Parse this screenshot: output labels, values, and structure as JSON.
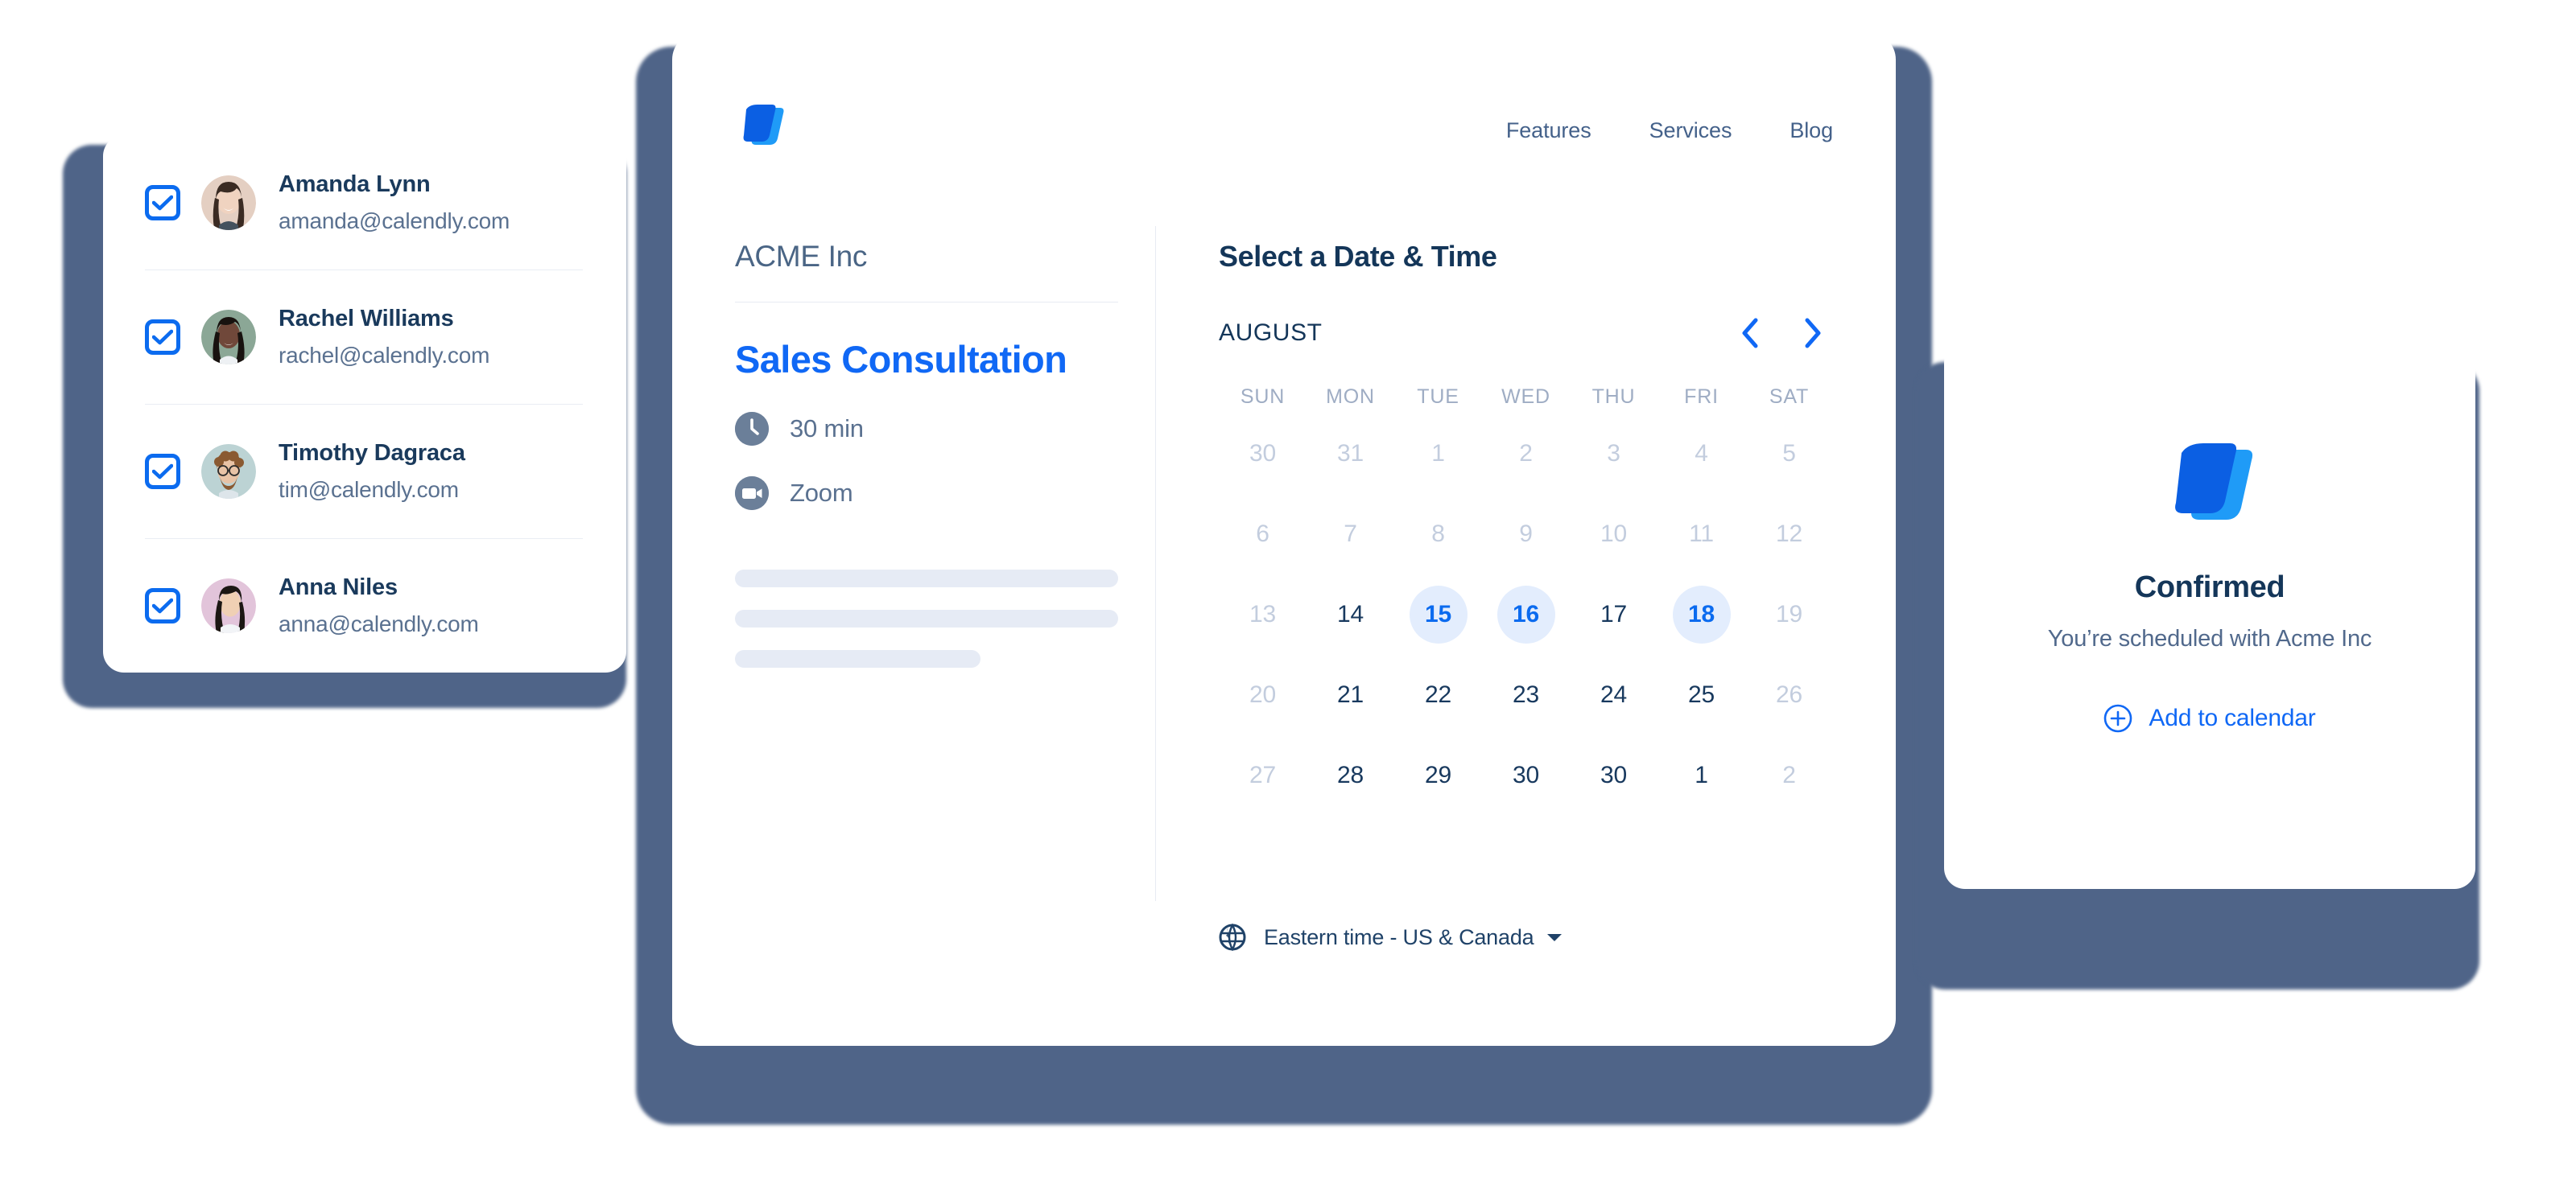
{
  "brand": {
    "logo_icon": "calendly-logo-icon",
    "logo_color_front": "#0b6bef",
    "logo_color_back": "#1f9bf7"
  },
  "contacts_panel": {
    "name": "contact-selection-list",
    "items": [
      {
        "checkbox_icon": "checkbox-checked-icon",
        "checked": true,
        "avatar_icon": "avatar-amanda-lynn",
        "avatar_bg": "#e4cfc2",
        "name": "Amanda Lynn",
        "email": "amanda@calendly.com"
      },
      {
        "checkbox_icon": "checkbox-checked-icon",
        "checked": true,
        "avatar_icon": "avatar-rachel-williams",
        "avatar_bg": "#8ba796",
        "name": "Rachel Williams",
        "email": "rachel@calendly.com"
      },
      {
        "checkbox_icon": "checkbox-checked-icon",
        "checked": true,
        "avatar_icon": "avatar-timothy-dagraca",
        "avatar_bg": "#bcd3d4",
        "name": "Timothy Dagraca",
        "email": "tim@calendly.com"
      },
      {
        "checkbox_icon": "checkbox-checked-icon",
        "checked": true,
        "avatar_icon": "avatar-anna-niles",
        "avatar_bg": "#e2c4da",
        "name": "Anna Niles",
        "email": "anna@calendly.com"
      }
    ]
  },
  "booking_page": {
    "header": {
      "logo_icon": "calendly-logo-icon",
      "nav": [
        {
          "label": "Features"
        },
        {
          "label": "Services"
        },
        {
          "label": "Blog"
        }
      ]
    },
    "event": {
      "organization": "ACME Inc",
      "title": "Sales Consultation",
      "title_color": "#1068f5",
      "duration_icon": "clock-icon",
      "duration": "30 min",
      "location_icon": "video-camera-icon",
      "location": "Zoom",
      "description_placeholders": 3
    },
    "calendar": {
      "heading": "Select a Date & Time",
      "month": "AUGUST",
      "prev_icon": "chevron-left-icon",
      "next_icon": "chevron-right-icon",
      "day_headers": [
        "SUN",
        "MON",
        "TUE",
        "WED",
        "THU",
        "FRI",
        "SAT"
      ],
      "weeks": [
        [
          {
            "day": "30",
            "state": "muted"
          },
          {
            "day": "31",
            "state": "muted"
          },
          {
            "day": "1",
            "state": "muted"
          },
          {
            "day": "2",
            "state": "muted"
          },
          {
            "day": "3",
            "state": "muted"
          },
          {
            "day": "4",
            "state": "muted"
          },
          {
            "day": "5",
            "state": "muted"
          }
        ],
        [
          {
            "day": "6",
            "state": "muted"
          },
          {
            "day": "7",
            "state": "muted"
          },
          {
            "day": "8",
            "state": "muted"
          },
          {
            "day": "9",
            "state": "muted"
          },
          {
            "day": "10",
            "state": "muted"
          },
          {
            "day": "11",
            "state": "muted"
          },
          {
            "day": "12",
            "state": "muted"
          }
        ],
        [
          {
            "day": "13",
            "state": "muted"
          },
          {
            "day": "14",
            "state": "normal"
          },
          {
            "day": "15",
            "state": "selectable"
          },
          {
            "day": "16",
            "state": "selectable"
          },
          {
            "day": "17",
            "state": "normal"
          },
          {
            "day": "18",
            "state": "selectable"
          },
          {
            "day": "19",
            "state": "muted"
          }
        ],
        [
          {
            "day": "20",
            "state": "muted"
          },
          {
            "day": "21",
            "state": "normal"
          },
          {
            "day": "22",
            "state": "normal"
          },
          {
            "day": "23",
            "state": "normal"
          },
          {
            "day": "24",
            "state": "normal"
          },
          {
            "day": "25",
            "state": "normal"
          },
          {
            "day": "26",
            "state": "muted"
          }
        ],
        [
          {
            "day": "27",
            "state": "muted"
          },
          {
            "day": "28",
            "state": "normal"
          },
          {
            "day": "29",
            "state": "normal"
          },
          {
            "day": "30",
            "state": "normal"
          },
          {
            "day": "30",
            "state": "normal"
          },
          {
            "day": "1",
            "state": "normal"
          },
          {
            "day": "2",
            "state": "muted"
          }
        ]
      ],
      "selected_highlight_bg": "#e3edfd",
      "selected_highlight_color": "#0b6bef"
    },
    "timezone": {
      "icon": "globe-icon",
      "label": "Eastern time - US & Canada",
      "caret_icon": "caret-down-icon"
    }
  },
  "confirmation_card": {
    "logo_icon": "calendly-logo-icon",
    "title": "Confirmed",
    "subtitle": "You’re scheduled with Acme Inc",
    "action_icon": "plus-circle-icon",
    "action_label": "Add to calendar"
  }
}
